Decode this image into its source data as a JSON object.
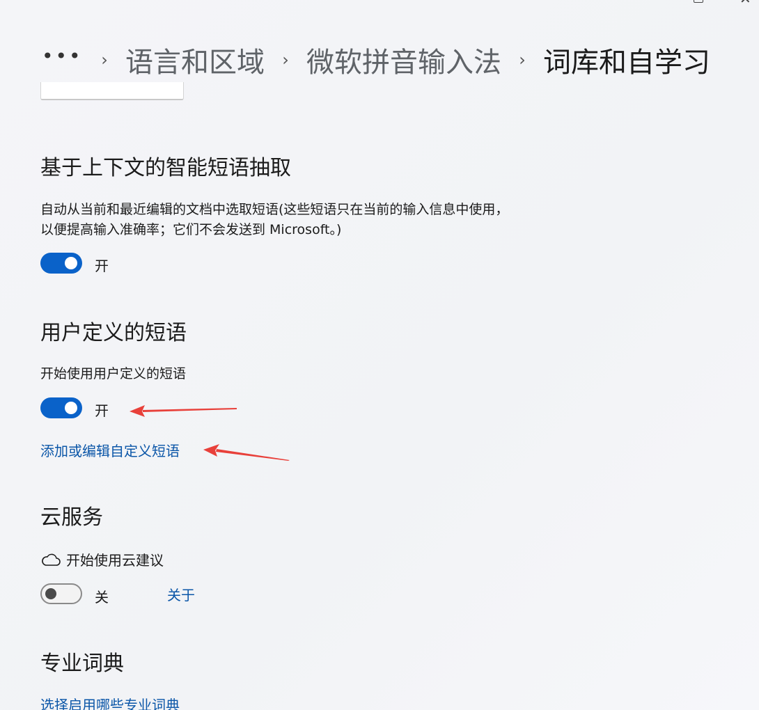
{
  "breadcrumb": {
    "more": "•••",
    "separator": "›",
    "items": [
      "语言和区域",
      "微软拼音输入法"
    ],
    "current": "词库和自学习"
  },
  "clipped_combo": {
    "text": "·······"
  },
  "sections": {
    "context_phrase": {
      "title": "基于上下文的智能短语抽取",
      "description": "自动从当前和最近编辑的文档中选取短语(这些短语只在当前的输入信息中使用，以便提高输入准确率；它们不会发送到 Microsoft。)",
      "toggle_state": "on",
      "toggle_label": "开"
    },
    "user_phrase": {
      "title": "用户定义的短语",
      "setting_label": "开始使用用户定义的短语",
      "toggle_state": "on",
      "toggle_label": "开",
      "edit_link": "添加或编辑自定义短语"
    },
    "cloud": {
      "title": "云服务",
      "setting_label": "开始使用云建议",
      "setting_icon": "cloud-icon",
      "toggle_state": "off",
      "toggle_label": "关",
      "about_link": "关于"
    },
    "dictionary": {
      "title": "专业词典",
      "link": "选择启用哪些专业词典"
    }
  },
  "colors": {
    "accent": "#0a62c9",
    "link": "#0b56a8",
    "annotation_arrow": "#e8403a"
  }
}
